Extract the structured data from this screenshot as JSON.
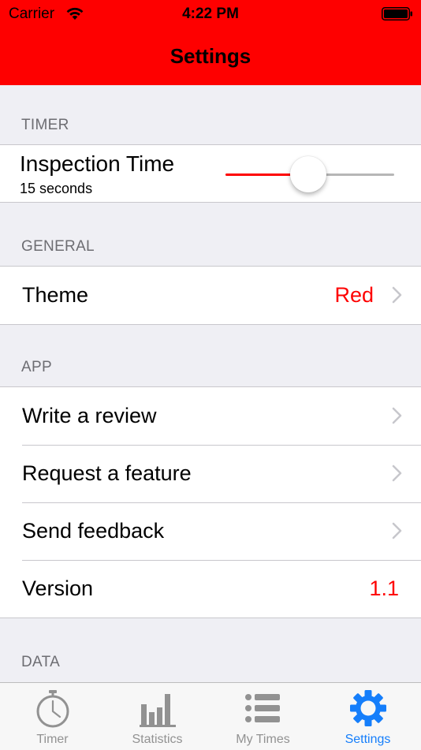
{
  "status_bar": {
    "carrier": "Carrier",
    "time": "4:22 PM"
  },
  "nav": {
    "title": "Settings"
  },
  "colors": {
    "accent": "#fe0000",
    "tab_active": "#157efb",
    "tab_inactive": "#929292"
  },
  "sections": {
    "timer": {
      "header": "TIMER",
      "inspection_label": "Inspection Time",
      "inspection_value": "15 seconds",
      "slider_fraction": 0.49
    },
    "general": {
      "header": "GENERAL",
      "theme_label": "Theme",
      "theme_value": "Red"
    },
    "app": {
      "header": "APP",
      "review_label": "Write a review",
      "feature_label": "Request a feature",
      "feedback_label": "Send feedback",
      "version_label": "Version",
      "version_value": "1.1"
    },
    "data": {
      "header": "DATA"
    }
  },
  "tab_bar": {
    "items": [
      {
        "label": "Timer",
        "icon": "stopwatch-icon",
        "active": false
      },
      {
        "label": "Statistics",
        "icon": "bar-chart-icon",
        "active": false
      },
      {
        "label": "My Times",
        "icon": "list-icon",
        "active": false
      },
      {
        "label": "Settings",
        "icon": "gear-icon",
        "active": true
      }
    ]
  }
}
